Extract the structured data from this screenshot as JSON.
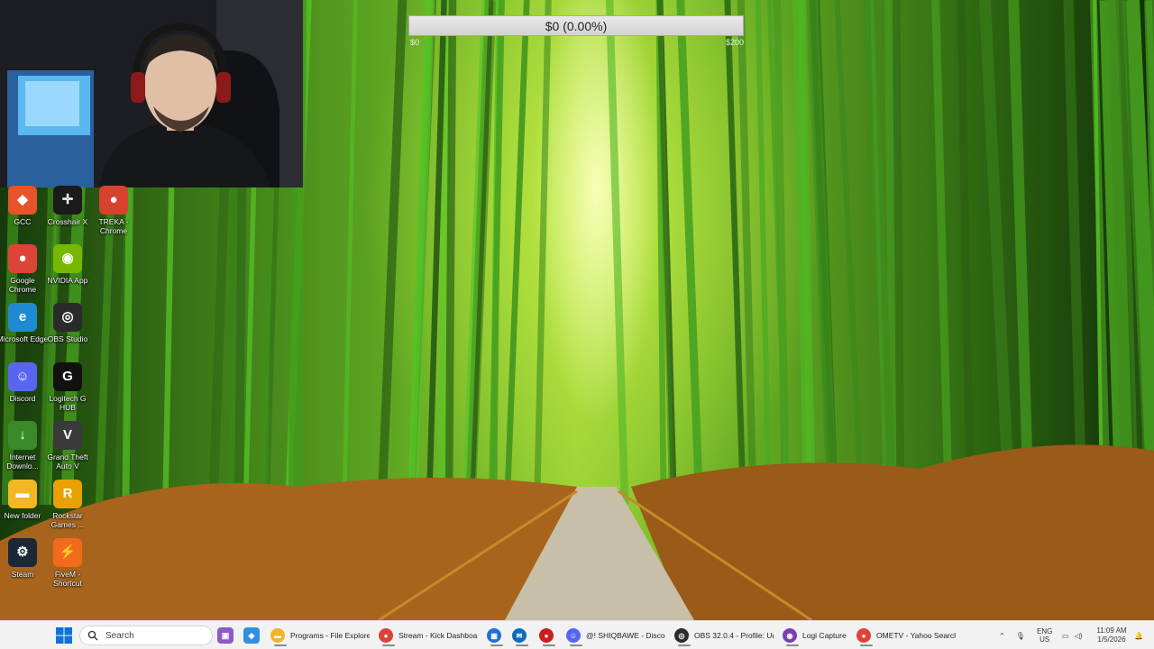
{
  "goal": {
    "label": "$0 (0.00%)",
    "min_label": "$0",
    "max_label": "$200",
    "progress_percent": 0,
    "fill_color": "#53b3ff"
  },
  "desktop_icons": [
    {
      "label": "GCC",
      "icon": "gcc-icon",
      "color": "#e8542a",
      "glyph": "◆"
    },
    {
      "label": "Crosshair X",
      "icon": "crosshair-x-icon",
      "color": "#1a1a1a",
      "glyph": "✛"
    },
    {
      "label": "TREKA - Chrome",
      "icon": "chrome-icon",
      "color": "#d9412f",
      "glyph": "●"
    },
    {
      "label": "Google Chrome",
      "icon": "chrome-icon",
      "color": "#db4437",
      "glyph": "●"
    },
    {
      "label": "NVIDIA App",
      "icon": "nvidia-icon",
      "color": "#76b900",
      "glyph": "◉"
    },
    {
      "label": "Microsoft Edge",
      "icon": "edge-icon",
      "color": "#1f8ad1",
      "glyph": "e"
    },
    {
      "label": "OBS Studio",
      "icon": "obs-icon",
      "color": "#2b2b2b",
      "glyph": "◎"
    },
    {
      "label": "Discord",
      "icon": "discord-icon",
      "color": "#5865f2",
      "glyph": "☺"
    },
    {
      "label": "Logitech G HUB",
      "icon": "logitech-icon",
      "color": "#111111",
      "glyph": "G"
    },
    {
      "label": "Internet Downlo...",
      "icon": "idm-icon",
      "color": "#3b8a2a",
      "glyph": "↓"
    },
    {
      "label": "Grand Theft Auto V",
      "icon": "gta-icon",
      "color": "#3a3a3a",
      "glyph": "V"
    },
    {
      "label": "New folder",
      "icon": "folder-icon",
      "color": "#f3b624",
      "glyph": "▬"
    },
    {
      "label": "Rockstar Games ...",
      "icon": "rockstar-icon",
      "color": "#e8a100",
      "glyph": "R"
    },
    {
      "label": "Steam",
      "icon": "steam-icon",
      "color": "#1b2838",
      "glyph": "⚙"
    },
    {
      "label": "FiveM - Shortcut",
      "icon": "fivem-icon",
      "color": "#f26b1d",
      "glyph": "⚡"
    }
  ],
  "taskbar": {
    "search_label": "Search",
    "pinned": [
      {
        "icon": "task-view-icon",
        "color": "#8e59c9",
        "glyph": "▣"
      },
      {
        "icon": "copilot-icon",
        "color": "#2f8fe0",
        "glyph": "◈"
      }
    ],
    "apps": [
      {
        "label": "Programs - File Explorer",
        "icon": "file-explorer-icon",
        "color": "#f0b429",
        "glyph": "▬"
      },
      {
        "label": "Stream - Kick Dashboard",
        "icon": "chrome-icon",
        "color": "#db4437",
        "glyph": "●"
      },
      {
        "label": "",
        "icon": "store-icon",
        "color": "#1e6fd9",
        "glyph": "▦"
      },
      {
        "label": "",
        "icon": "outlook-icon",
        "color": "#0f6cbd",
        "glyph": "✉"
      },
      {
        "label": "",
        "icon": "record-icon",
        "color": "#c81e1e",
        "glyph": "●"
      },
      {
        "label": "@! SHIQBAWE - Discord",
        "icon": "discord-icon",
        "color": "#5865f2",
        "glyph": "☺"
      },
      {
        "label": "OBS 32.0.4 - Profile: Unt",
        "icon": "obs-icon",
        "color": "#2b2b2b",
        "glyph": "◎"
      },
      {
        "label": "Logi Capture",
        "icon": "logi-capture-icon",
        "color": "#7b3fb5",
        "glyph": "◉"
      },
      {
        "label": "OMETV - Yahoo Search",
        "icon": "chrome-icon",
        "color": "#db4437",
        "glyph": "●"
      }
    ],
    "tray": {
      "lang_top": "ENG",
      "lang_bottom": "US",
      "time": "11:09 AM",
      "date": "1/5/2026"
    }
  }
}
